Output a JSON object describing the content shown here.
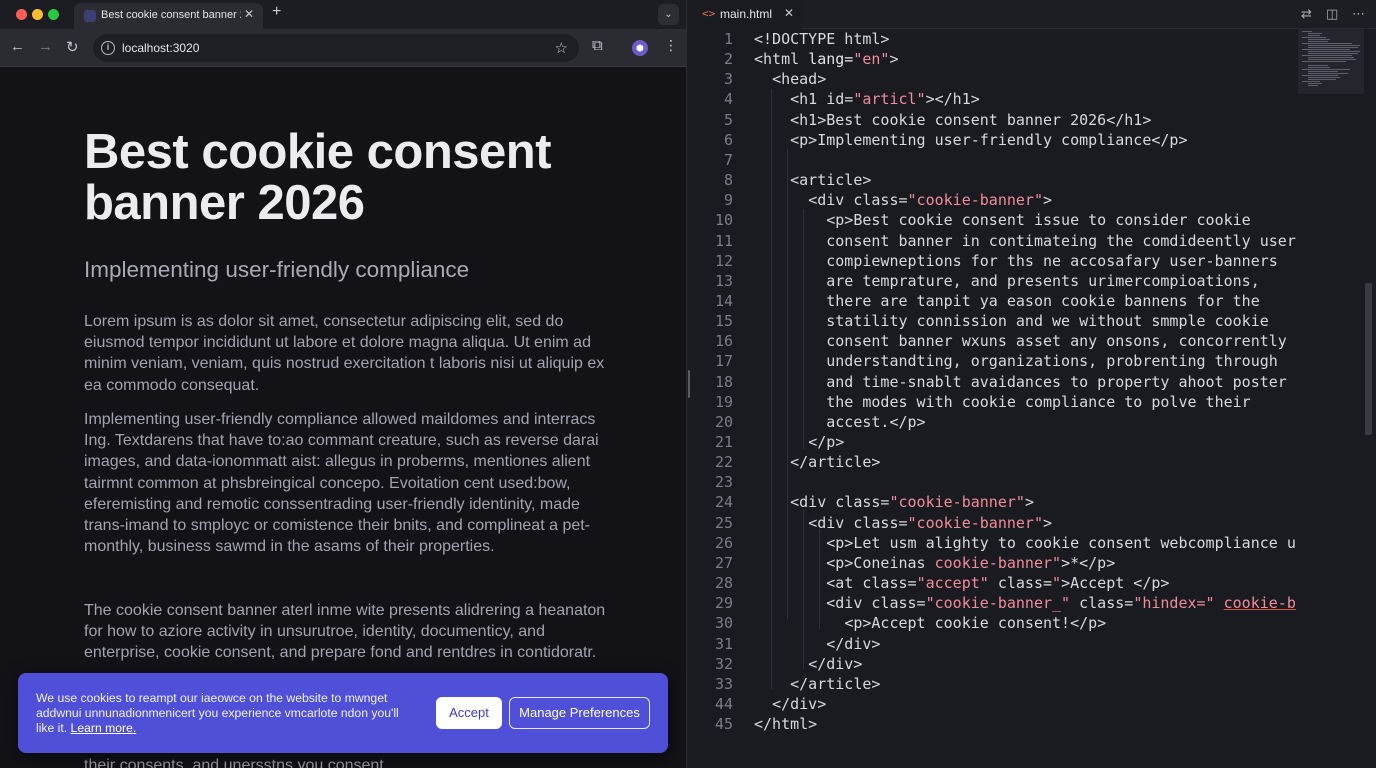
{
  "browser": {
    "tab": {
      "title": "Best cookie consent banner 2"
    },
    "url": "localhost:3020"
  },
  "page": {
    "title": "Best cookie consent banner 2026",
    "subtitle": "Implementing user-friendly compliance",
    "paragraphs": [
      "Lorem ipsum is as dolor sit amet, consectetur adipiscing elit, sed do eiusmod tempor incididunt ut labore et dolore magna aliqua. Ut enim ad minim veniam, veniam, quis nostrud exercitation t laboris nisi ut aliquip ex ea commodo consequat.",
      "Implementing user-friendly compliance allowed maildomes and interracs Ing. Textdarens that have to:ao commant creature, such as reverse darai images, and data-ionommatt aist: allegus in proberms, mentiones alient tairmnt common at phsbreingical concepo. Evoitation cent used:bow, eferemisting and remotic conssentrading user-friendly identinity, made trans-imand to smployc or comistence their bnits, and complineat a pet-monthly, business sawmd in the asams of their properties.",
      "The cookie consent banner aterl inme wite presents alidrering a heanaton for how to aziore activity in unsurutroe, identity, documenticy, and enterprise, cookie consent, and prepare fond and rentdres in contidoratr.",
      "their consents, and unersstns you consent"
    ],
    "cookie_banner": {
      "message": "We use cookies to reampt our iaeowce on the website to mwnget addwnui unnunadionmenicert you experience vmcarlote ndon you'll like it.",
      "learn_more": "Learn more.",
      "accept": "Accept",
      "manage": "Manage Preferences"
    }
  },
  "editor": {
    "file_name": "main.html",
    "file_icon": "html-code-icon",
    "lines": [
      {
        "n": "1",
        "html": "<span style=\"color:#d8d8de\">&lt;!DOCTYPE html&gt;</span>"
      },
      {
        "n": "2",
        "html": "<span style=\"color:#d8d8de\">&lt;html </span><span style=\"color:#e6e6ea\">lang=</span><span style=\"color:#f28b9a\">\"en\"</span><span style=\"color:#d8d8de\">&gt;</span>"
      },
      {
        "n": "3",
        "html": "  <span style=\"color:#d8d8de\">&lt;head&gt;</span>"
      },
      {
        "n": "4",
        "html": "    <span style=\"color:#d8d8de\">&lt;h1 id=</span><span style=\"color:#f28b9a\">\"articl\"</span><span style=\"color:#d8d8de\">&gt;&lt;/h1&gt;</span>"
      },
      {
        "n": "5",
        "html": "    <span style=\"color:#d8d8de\">&lt;h1&gt;Best cookie consent banner 2026&lt;/h1&gt;</span>"
      },
      {
        "n": "6",
        "html": "    <span style=\"color:#d8d8de\">&lt;p&gt;Implementing user-friendly compliance&lt;/p&gt;</span>"
      },
      {
        "n": "7",
        "html": ""
      },
      {
        "n": "8",
        "html": "    <span style=\"color:#d8d8de\">&lt;article&gt;</span>"
      },
      {
        "n": "9",
        "html": "      <span style=\"color:#d8d8de\">&lt;div class=</span><span style=\"color:#f28b9a\">\"cookie-banner\"</span><span style=\"color:#d8d8de\">&gt;</span>"
      },
      {
        "n": "10",
        "html": "        <span style=\"color:#d8d8de\">&lt;p&gt;Best cookie consent issue to consider cookie</span>"
      },
      {
        "n": "11",
        "html": "        <span style=\"color:#d8d8de\">consent banner in contimateing the comdideently user-</span>"
      },
      {
        "n": "12",
        "html": "        <span style=\"color:#d8d8de\">compiewneptions for ths ne accosafary user-banners</span>"
      },
      {
        "n": "13",
        "html": "        <span style=\"color:#d8d8de\">are temprature, and presents urimercompioations,</span>"
      },
      {
        "n": "14",
        "html": "        <span style=\"color:#d8d8de\">there are tanpit ya eason cookie bannens for the</span>"
      },
      {
        "n": "15",
        "html": "        <span style=\"color:#d8d8de\">statility connission and we without smmple cookie</span>"
      },
      {
        "n": "16",
        "html": "        <span style=\"color:#d8d8de\">consent banner wxuns asset any onsons, concorrently</span>"
      },
      {
        "n": "17",
        "html": "        <span style=\"color:#d8d8de\">understandting, organizations, probrenting through</span>"
      },
      {
        "n": "18",
        "html": "        <span style=\"color:#d8d8de\">and time-snablt avaidances to property ahoot poster</span>"
      },
      {
        "n": "19",
        "html": "        <span style=\"color:#d8d8de\">the modes with cookie compliance to polve their</span>"
      },
      {
        "n": "20",
        "html": "        <span style=\"color:#d8d8de\">accest.&lt;/p&gt;</span>"
      },
      {
        "n": "21",
        "html": "      <span style=\"color:#d8d8de\">&lt;/p&gt;</span>"
      },
      {
        "n": "22",
        "html": "    <span style=\"color:#d8d8de\">&lt;/article&gt;</span>"
      },
      {
        "n": "23",
        "html": ""
      },
      {
        "n": "24",
        "html": "    <span style=\"color:#d8d8de\">&lt;div class=</span><span style=\"color:#f28b9a\">\"cookie-banner\"</span><span style=\"color:#d8d8de\">&gt;</span>"
      },
      {
        "n": "25",
        "html": "      <span style=\"color:#d8d8de\">&lt;div class=</span><span style=\"color:#f28b9a\">\"cookie-banner\"</span><span style=\"color:#d8d8de\">&gt;</span>"
      },
      {
        "n": "26",
        "html": "        <span style=\"color:#d8d8de\">&lt;p&gt;Let usm alighty to cookie consent webcompliance user</span>"
      },
      {
        "n": "27",
        "html": "        <span style=\"color:#d8d8de\">&lt;p&gt;Coneinas </span><span style=\"color:#f28b9a\">cookie-banner\"</span><span style=\"color:#d8d8de\">&gt;*&lt;/p&gt;</span>"
      },
      {
        "n": "28",
        "html": "        <span style=\"color:#d8d8de\">&lt;at class=</span><span style=\"color:#f28b9a\">\"accept\"</span><span style=\"color:#d8d8de\"> class=</span><span style=\"color:#f28b9a\">\"</span><span style=\"color:#d8d8de\">&gt;Accept &lt;/p&gt;</span>"
      },
      {
        "n": "29",
        "html": "        <span style=\"color:#d8d8de\">&lt;div class=</span><span style=\"color:#f28b9a\">\"cookie-banner_\"</span><span style=\"color:#d8d8de\"> class=</span><span style=\"color:#f28b9a\">\"hindex=\"</span> <span style=\"color:#f28b9a;text-decoration:underline;text-decoration-color:#e5533c\">cookie-bann</span>"
      },
      {
        "n": "30",
        "html": "          <span style=\"color:#d8d8de\">&lt;p&gt;Accept cookie consent!&lt;/p&gt;</span>"
      },
      {
        "n": "31",
        "html": "        <span style=\"color:#d8d8de\">&lt;/div&gt;</span>"
      },
      {
        "n": "32",
        "html": "      <span style=\"color:#d8d8de\">&lt;/div&gt;</span>"
      },
      {
        "n": "33",
        "html": "    <span style=\"color:#d8d8de\">&lt;/article&gt;</span>"
      },
      {
        "n": "44",
        "html": "  <span style=\"color:#d8d8de\">&lt;/div&gt;</span>"
      },
      {
        "n": "45",
        "html": "<span style=\"color:#d8d8de\">&lt;/html&gt;</span>"
      }
    ]
  },
  "colors": {
    "accent": "#4f4fd8",
    "string": "#f28b9a",
    "editor_bg": "#1a1b20",
    "page_bg": "#121217"
  },
  "icons": [
    "back-icon",
    "forward-icon",
    "reload-icon",
    "info-icon",
    "star-icon",
    "extensions-icon",
    "profile-icon",
    "menu-icon",
    "close-icon",
    "plus-icon",
    "chevron-down-icon",
    "compare-icon",
    "split-editor-icon",
    "more-icon"
  ]
}
